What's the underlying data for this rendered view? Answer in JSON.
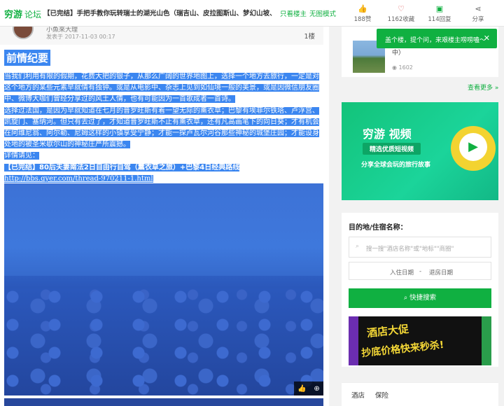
{
  "topbar": {
    "logo": "穷游",
    "logo_sub": "论坛",
    "thread_title": "【已完结】手把手教你玩转瑞士的湖光山色（瑞吉山、皮拉图斯山、梦幻山坡、少女峰...",
    "only_author": "只看楼主",
    "no_image": "无图模式",
    "stats": [
      {
        "icon": "like-icon",
        "label": "188赞"
      },
      {
        "icon": "heart-icon",
        "label": "1162收藏"
      },
      {
        "icon": "reply-icon",
        "label": "114回复"
      },
      {
        "icon": "share-icon",
        "label": "分享"
      }
    ]
  },
  "post": {
    "author": "小魚來大理",
    "time": "发表于 2017-11-03 00:17",
    "floor": "1楼",
    "heading": "前情纪要",
    "paragraphs": [
      "当我们利用有限的假期，花费大把的银子，从那么广阔的世界地图上，选择一个地方去旅行，一定是对这个地方的某些元素早就情有独钟。或是从电影中、杂志上见到如仙境一般的美景，或是因微信朋友圈中、微博大咖们曾经分享过的风土人情，也有可能因为一首歌成者一首诗。",
      "选择过法国，是因为早就知道在七月的普罗旺斯有着一望无际的薰衣草；巴黎有埃菲尔铁塔、卢浮宫、凯旋门、塞纳河。但只有去过了，才知道普罗旺斯不止有薰衣草，还有凡高画笔下的向日葵；才有机会在阿维尼翁、阿尔勒、尼姆这样的小镇享受宁静；才能一探卢瓦尔河谷那些神秘的城堡庄园；才能设身处地的被圣米歇尔山的神秘庄严所震撼。",
      "详情请见：",
      "【已完结】80后夫妻南法2日自由行自驾（薰衣草之旅）+巴黎4日经典路线",
      "http://bbs.qyer.com/thread-970211-1.html"
    ]
  },
  "photo": {
    "like_icon": "thumb-up-icon",
    "zoom_icon": "zoom-icon"
  },
  "sidebar": {
    "toast": "盖个楼，提个问，来艰楼主唠唠嗑～",
    "rec_text": "中）",
    "rec_views": "1602",
    "see_more": "查看更多 »",
    "banner": {
      "title": "穷游 视频",
      "pill": "精选优质短视频",
      "sub": "分享全球会玩的旅行故事"
    },
    "search": {
      "title": "目的地/住宿名称：",
      "placeholder": "搜一搜\"酒店名称\"或\"地标\"\"商圈\"",
      "checkin": "入住日期",
      "dash": "-",
      "checkout": "退房日期",
      "button": "快捷搜索"
    },
    "ad": {
      "line1": "酒店大促",
      "line2": "抄底价格快来秒杀!"
    },
    "tabs": [
      "酒店",
      "保险"
    ]
  },
  "colors": {
    "brand": "#10b041",
    "selection": "#3b86f0"
  }
}
